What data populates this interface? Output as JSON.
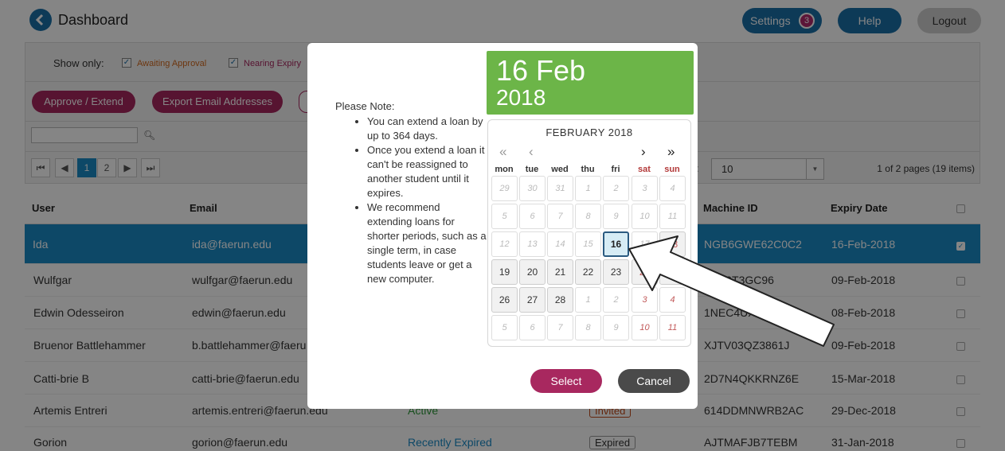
{
  "header": {
    "title": "Dashboard",
    "settings_label": "Settings",
    "settings_count": "3",
    "help_label": "Help",
    "logout_label": "Logout"
  },
  "filters": {
    "show_only_label": "Show only:",
    "awaiting_approval": "Awaiting Approval",
    "nearing_expiry": "Nearing Expiry",
    "awaiting_color": "#d2691e",
    "nearing_color": "#a8285f"
  },
  "actions": {
    "approve_extend": "Approve / Extend",
    "export_emails": "Export Email Addresses"
  },
  "pager": {
    "first": "⏮",
    "prev": "◀",
    "pages": [
      "1",
      "2"
    ],
    "next": "▶",
    "last": "⏭",
    "per_page_label": ":",
    "per_page": "10",
    "info": "1 of 2 pages (19 items)"
  },
  "table": {
    "columns": {
      "user": "User",
      "email": "Email",
      "machine_id": "Machine ID",
      "expiry_date": "Expiry Date"
    },
    "rows": [
      {
        "user": "Ida",
        "email": "ida@faerun.edu",
        "status": "",
        "tag": "",
        "machine_id": "NGB6GWE62C0C2",
        "expiry": "16-Feb-2018",
        "selected": true
      },
      {
        "user": "Wulfgar",
        "email": "wulfgar@faerun.edu",
        "status": "",
        "tag": "",
        "machine_id": "Q7Z0T3GC96",
        "expiry": "09-Feb-2018"
      },
      {
        "user": "Edwin Odesseiron",
        "email": "edwin@faerun.edu",
        "status": "",
        "tag": "",
        "machine_id": "1NEC4UX",
        "expiry": "08-Feb-2018"
      },
      {
        "user": "Bruenor Battlehammer",
        "email": "b.battlehammer@faeru",
        "status": "",
        "tag": "",
        "machine_id": "XJTV03QZ3861J",
        "expiry": "09-Feb-2018"
      },
      {
        "user": "Catti-brie B",
        "email": "catti-brie@faerun.edu",
        "status": "",
        "tag": "",
        "machine_id": "2D7N4QKKRNZ6E",
        "expiry": "15-Mar-2018"
      },
      {
        "user": "Artemis Entreri",
        "email": "artemis.entreri@faerun.edu",
        "status": "Active",
        "tag": "Invited",
        "machine_id": "614DDMNWRB2AC",
        "expiry": "29-Dec-2018"
      },
      {
        "user": "Gorion",
        "email": "gorion@faerun.edu",
        "status": "Recently Expired",
        "tag": "Expired",
        "machine_id": "AJTMAFJB7TEBM",
        "expiry": "31-Jan-2018"
      }
    ]
  },
  "modal": {
    "note_title": "Please Note:",
    "notes": [
      "You can extend a loan by up to 364 days.",
      "Once you extend a loan it can't be reassigned to another student until it expires.",
      "We recommend extending loans for shorter periods, such as a single term, in case students leave or get a new computer."
    ],
    "selected_day_month": "16 Feb",
    "selected_year": "2018",
    "header_color": "#6cb548",
    "calendar": {
      "month_label": "FEBRUARY 2018",
      "nav_first": "«",
      "nav_prev": "‹",
      "nav_next": "›",
      "nav_last": "»",
      "weekdays": [
        "mon",
        "tue",
        "wed",
        "thu",
        "fri",
        "sat",
        "sun"
      ],
      "weeks": [
        [
          "29",
          "30",
          "31",
          "1",
          "2",
          "3",
          "4"
        ],
        [
          "5",
          "6",
          "7",
          "8",
          "9",
          "10",
          "11"
        ],
        [
          "12",
          "13",
          "14",
          "15",
          "16",
          "17",
          "18"
        ],
        [
          "19",
          "20",
          "21",
          "22",
          "23",
          "24",
          "25"
        ],
        [
          "26",
          "27",
          "28",
          "1",
          "2",
          "3",
          "4"
        ],
        [
          "5",
          "6",
          "7",
          "8",
          "9",
          "10",
          "11"
        ]
      ],
      "selected_day": "16"
    },
    "select_label": "Select",
    "cancel_label": "Cancel"
  }
}
